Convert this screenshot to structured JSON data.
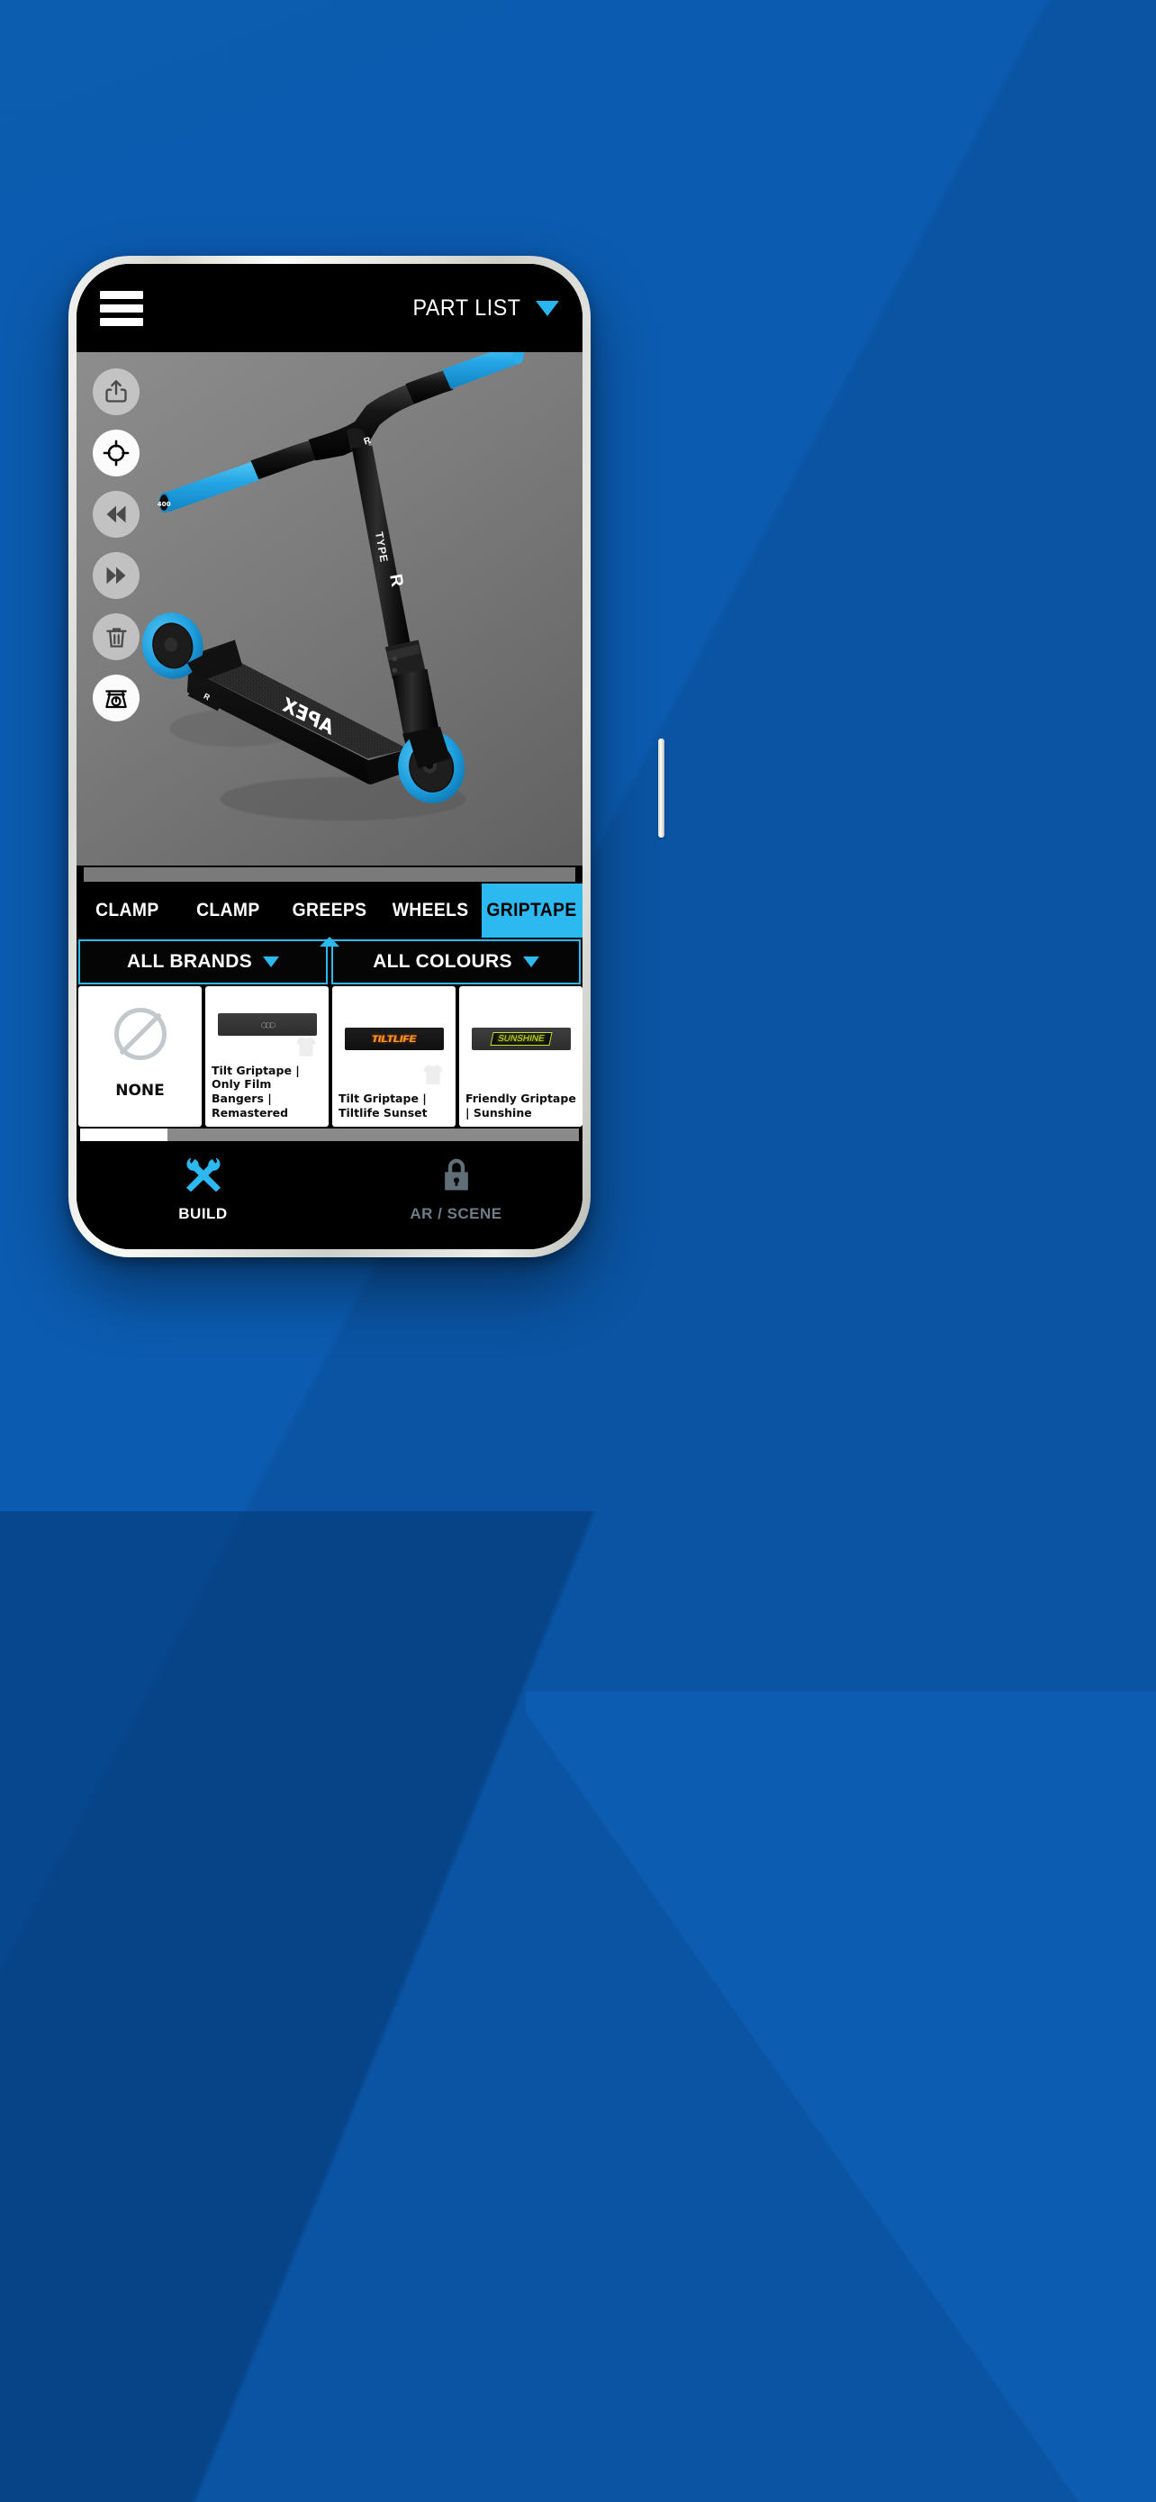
{
  "app": {
    "header": {
      "menu_icon": "hamburger-menu-icon",
      "part_list_label": "PART LIST",
      "part_list_chevron": "chevron-down-icon"
    }
  },
  "viewer": {
    "tools": [
      {
        "name": "share-icon",
        "label": "Share",
        "active": false
      },
      {
        "name": "target-icon",
        "label": "Recentre",
        "active": true
      },
      {
        "name": "rewind-icon",
        "label": "Rewind",
        "active": false
      },
      {
        "name": "forward-icon",
        "label": "Forward",
        "active": false
      },
      {
        "name": "trash-icon",
        "label": "Delete",
        "active": false
      },
      {
        "name": "scale-icon",
        "label": "Weight",
        "active": true
      }
    ],
    "model": {
      "brand_deck": "APEX",
      "brand_fork": "TYPE R",
      "bar_end_text": "400",
      "accent_colour": "#2aa9e8",
      "frame_colour": "#121212",
      "background_colour": "#7c7c7c"
    }
  },
  "tabs": [
    {
      "label": "CLAMP",
      "active": false
    },
    {
      "label": "CLAMP",
      "active": false
    },
    {
      "label": "GREEPS",
      "active": false
    },
    {
      "label": "WHEELS",
      "active": false
    },
    {
      "label": "GRIPTAPE",
      "active": true
    }
  ],
  "filters": [
    {
      "label": "ALL BRANDS",
      "chevron": "chevron-down-icon"
    },
    {
      "label": "ALL COLOURS",
      "chevron": "chevron-down-icon"
    }
  ],
  "cards": [
    {
      "label": "NONE",
      "thumb": "none-slash-icon"
    },
    {
      "label": "Tilt Griptape | Only Film Bangers | Remastered",
      "thumb": "griptape-dark-circles"
    },
    {
      "label": "Tilt Griptape | Tiltlife Sunset",
      "thumb": "griptape-tiltlife",
      "thumb_text": "TILTLIFE"
    },
    {
      "label": "Friendly Griptape | Sunshine",
      "thumb": "griptape-sunshine",
      "thumb_text": "SUNSHINE"
    }
  ],
  "scroll": {
    "horizontal_position_percent": 17.5
  },
  "bottom_nav": [
    {
      "label": "BUILD",
      "icon": "tools-icon",
      "state": "active"
    },
    {
      "label": "AR / SCENE",
      "icon": "lock-icon",
      "state": "locked"
    }
  ],
  "colors": {
    "accent_cyan": "#2bb9f0",
    "page_background": "#0a56a8",
    "screen_background": "#000000",
    "locked_grey": "#6f7d86"
  }
}
